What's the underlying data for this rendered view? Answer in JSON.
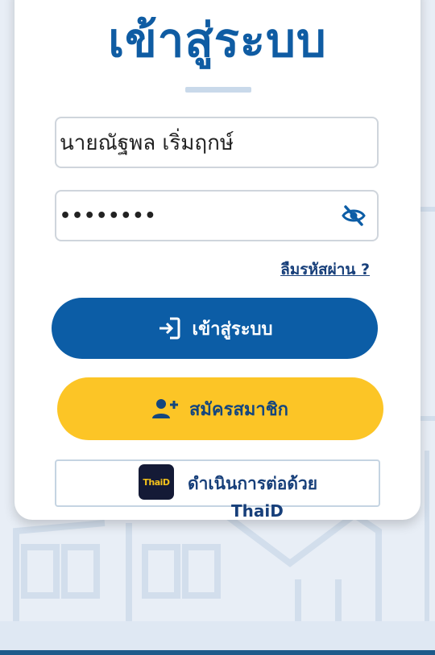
{
  "login_title": "เข้าสู่ระบบ",
  "username": {
    "value": "นายณัฐพล เริ่มฤกษ์"
  },
  "password": {
    "value": "••••••••"
  },
  "password_toggle_icon": "eye-slash-icon",
  "forgot_password_label": "ลืมรหัสผ่าน ?",
  "login_button": {
    "label": "เข้าสู่ระบบ",
    "icon": "sign-in-icon"
  },
  "register_button": {
    "label": "สมัครสมาชิก",
    "icon": "user-plus-icon"
  },
  "thaid_button": {
    "logo_text": "ThaiD",
    "label_line1": "ดำเนินการต่อด้วย",
    "label_line2": "ThaiD"
  },
  "colors": {
    "primary": "#0c5da6",
    "accent": "#fcc526",
    "text_dark": "#173f7a"
  }
}
